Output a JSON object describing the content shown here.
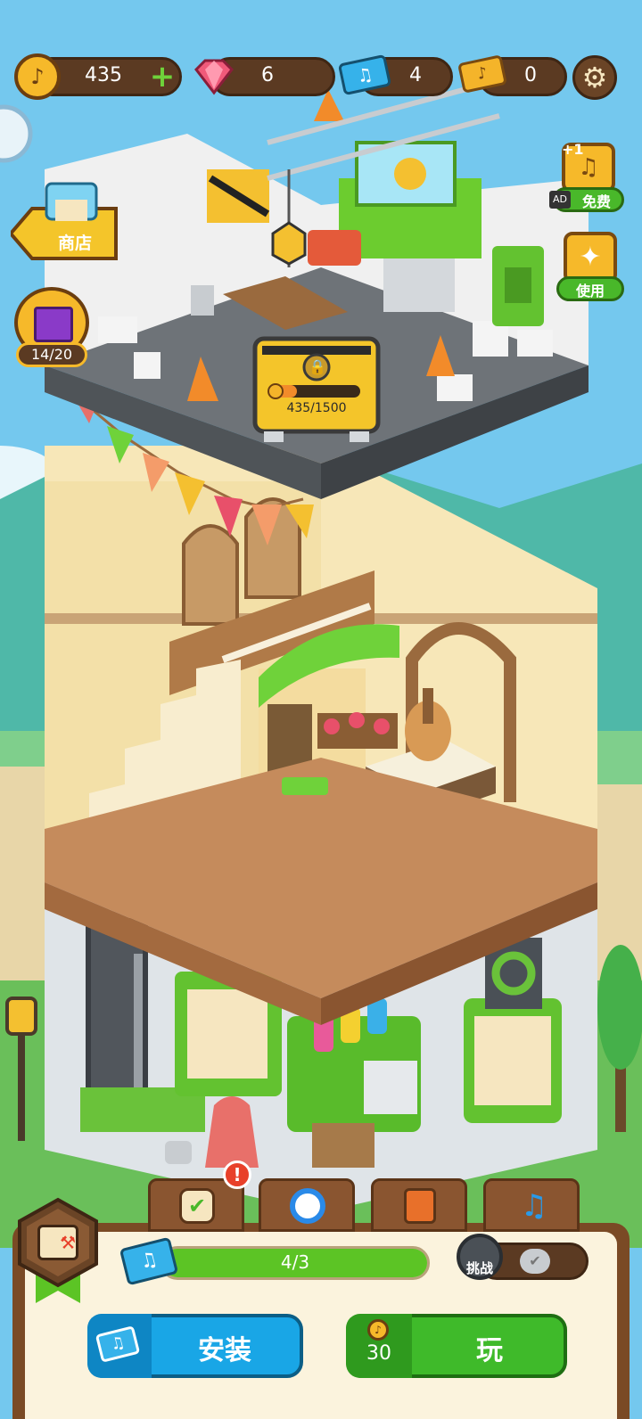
{
  "resources": {
    "coins": "435",
    "gems": "6",
    "music_tickets": "4",
    "gold_tickets": "0"
  },
  "left_panel": {
    "shop_label": "商店",
    "crate_progress": "14/20"
  },
  "right_panel": {
    "free_ad_badge": "+1",
    "free_ad_label": "免费",
    "ad_tag": "AD",
    "use_label": "使用"
  },
  "construction": {
    "progress_text": "435/1500",
    "progress_fraction": 0.29
  },
  "bottom": {
    "ticket_progress_text": "4/3",
    "ticket_progress_fraction": 1.0,
    "challenge_label": "挑战",
    "install_label": "安装",
    "play_cost": "30",
    "play_label": "玩"
  },
  "colors": {
    "sky": "#74c8ee",
    "accent_green": "#5cc425",
    "install_blue": "#19a6e6",
    "play_green": "#3fba2a"
  }
}
